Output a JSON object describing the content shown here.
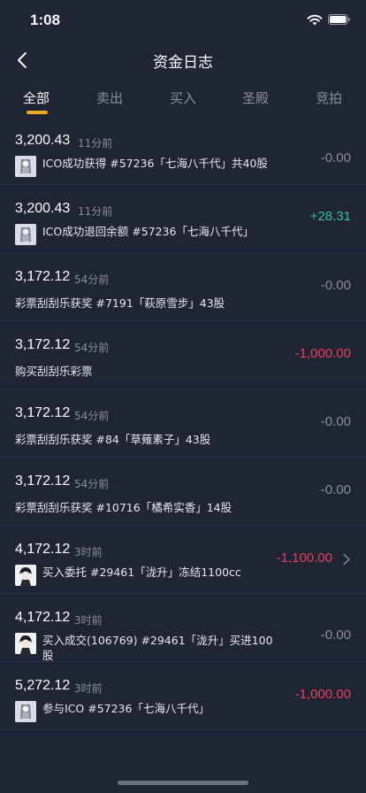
{
  "status_bar": {
    "time": "1:08"
  },
  "nav": {
    "title": "资金日志"
  },
  "tabs": [
    {
      "label": "全部",
      "active": true
    },
    {
      "label": "卖出"
    },
    {
      "label": "买入"
    },
    {
      "label": "圣殿"
    },
    {
      "label": "竞拍"
    }
  ],
  "entries": [
    {
      "balance": "3,200.43",
      "time": "11分前",
      "icon": "character-thumbnail-ico",
      "desc": "ICO成功获得 #57236「七海八千代」共40股",
      "amount": "-0.00",
      "amount_type": "zero"
    },
    {
      "balance": "3,200.43",
      "time": "11分前",
      "icon": "character-thumbnail-ico",
      "desc": "ICO成功退回余额 #57236「七海八千代」",
      "amount": "+28.31",
      "amount_type": "pos"
    },
    {
      "balance": "3,172.12",
      "time": "54分前",
      "desc": "彩票刮刮乐获奖 #7191「萩原雪步」43股",
      "amount": "-0.00",
      "amount_type": "zero"
    },
    {
      "balance": "3,172.12",
      "time": "54分前",
      "desc": "购买刮刮乐彩票",
      "amount": "-1,000.00",
      "amount_type": "neg"
    },
    {
      "balance": "3,172.12",
      "time": "54分前",
      "desc": "彩票刮刮乐获奖 #84「草薙素子」43股",
      "amount": "-0.00",
      "amount_type": "zero"
    },
    {
      "balance": "3,172.12",
      "time": "54分前",
      "desc": "彩票刮刮乐获奖 #10716「橘希实香」14股",
      "amount": "-0.00",
      "amount_type": "zero"
    },
    {
      "balance": "4,172.12",
      "time": "3时前",
      "icon": "character-thumbnail-longsheng",
      "desc": "买入委托 #29461「泷升」冻结1100cc",
      "amount": "-1,100.00",
      "amount_type": "neg",
      "chevron": true
    },
    {
      "balance": "4,172.12",
      "time": "3时前",
      "icon": "character-thumbnail-longsheng",
      "desc": "买入成交(106769) #29461「泷升」买进100股",
      "amount": "-0.00",
      "amount_type": "zero"
    },
    {
      "balance": "5,272.12",
      "time": "3时前",
      "icon": "character-thumbnail-ico",
      "desc": "参与ICO #57236「七海八千代」",
      "amount": "-1,000.00",
      "amount_type": "neg"
    }
  ],
  "colors": {
    "background": "#202536",
    "accent": "#f5a623",
    "positive": "#2ec48f",
    "negative": "#e8405a",
    "muted": "#8a8f9e"
  }
}
